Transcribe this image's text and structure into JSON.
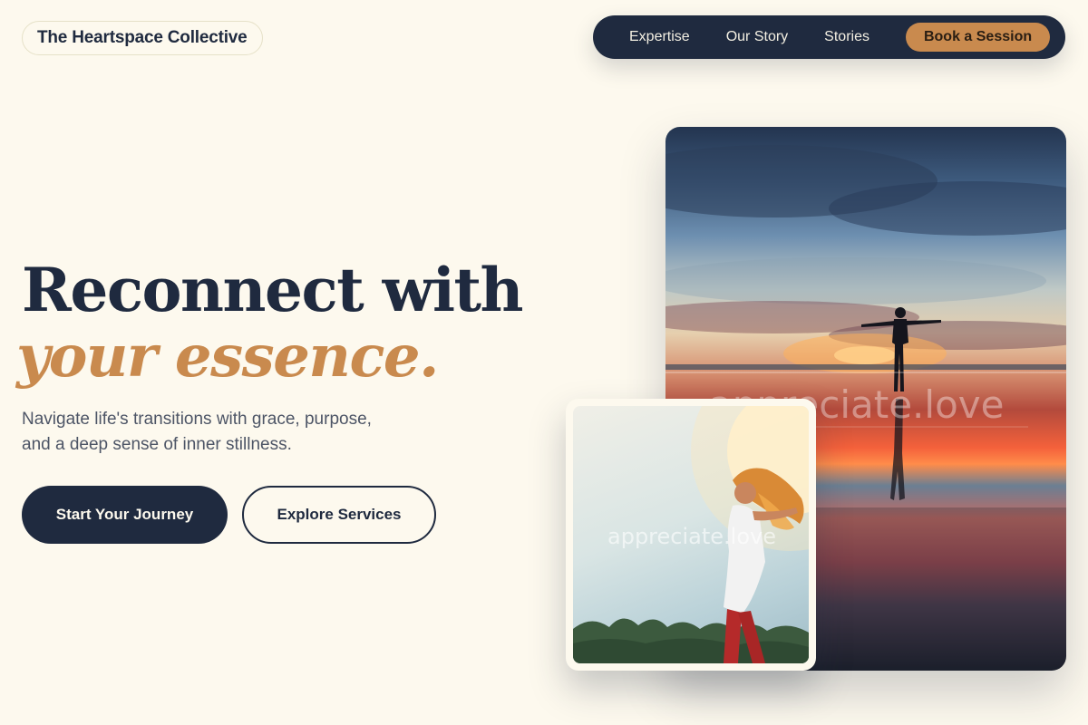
{
  "brand": {
    "name": "The Heartspace Collective"
  },
  "nav": {
    "links": [
      "Expertise",
      "Our Story",
      "Stories"
    ],
    "cta": "Book a Session"
  },
  "hero": {
    "headline_line1": "Reconnect with",
    "headline_line2": "your essence.",
    "subtitle_line1": "Navigate life's transitions with grace, purpose,",
    "subtitle_line2": "and a deep sense of inner stillness.",
    "primary_button": "Start Your Journey",
    "secondary_button": "Explore Services"
  },
  "images": {
    "main_watermark": "appreciate.love",
    "small_watermark": "appreciate.love"
  },
  "colors": {
    "background": "#fdf9ee",
    "navy": "#1f2a3f",
    "accent": "#c98a4e"
  }
}
